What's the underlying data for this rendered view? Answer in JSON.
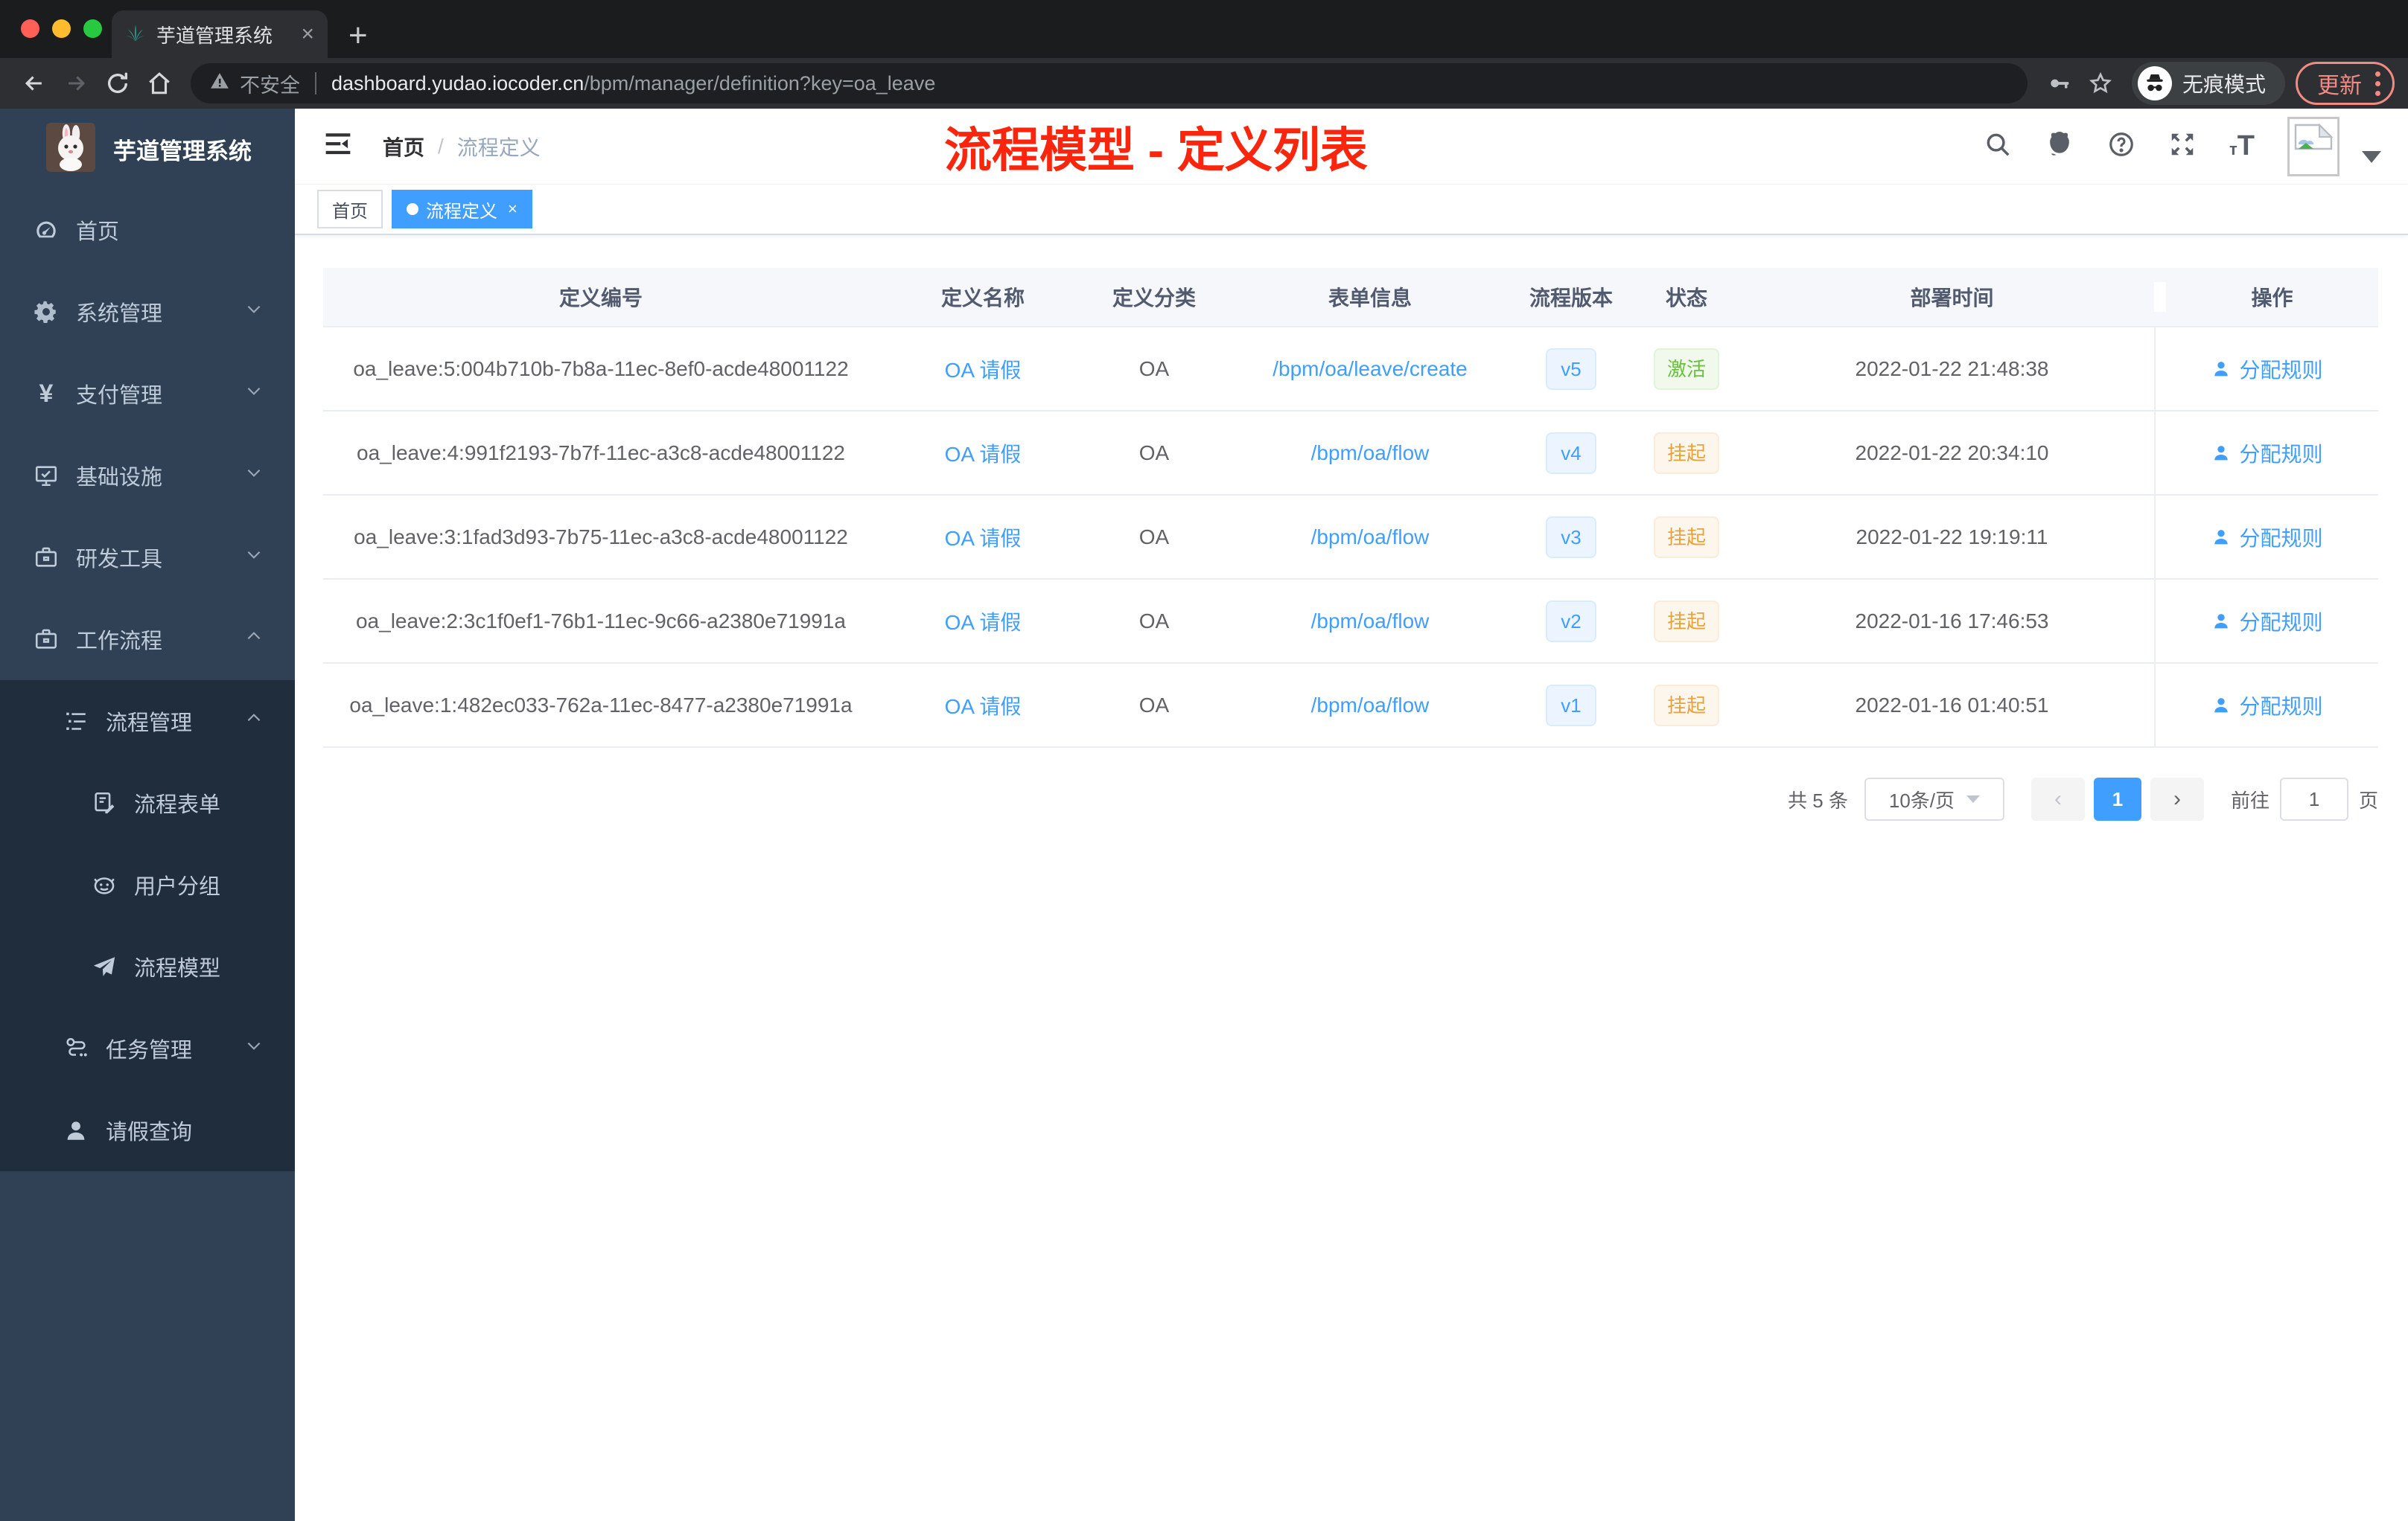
{
  "browser": {
    "tab_title": "芋道管理系统",
    "tab_close": "×",
    "new_tab": "+",
    "security_label": "不安全",
    "url_domain": "dashboard.yudao.iocoder.cn",
    "url_path": "/bpm/manager/definition?key=oa_leave",
    "incognito_label": "无痕模式",
    "update_label": "更新"
  },
  "sidebar": {
    "app_title": "芋道管理系统",
    "items": [
      {
        "label": "首页"
      },
      {
        "label": "系统管理"
      },
      {
        "label": "支付管理"
      },
      {
        "label": "基础设施"
      },
      {
        "label": "研发工具"
      },
      {
        "label": "工作流程"
      },
      {
        "label": "流程管理"
      },
      {
        "label": "流程表单"
      },
      {
        "label": "用户分组"
      },
      {
        "label": "流程模型"
      },
      {
        "label": "任务管理"
      },
      {
        "label": "请假查询"
      }
    ]
  },
  "header": {
    "breadcrumb_home": "首页",
    "breadcrumb_sep": "/",
    "breadcrumb_current": "流程定义",
    "annotation": "流程模型 - 定义列表"
  },
  "tags": {
    "home": "首页",
    "active": "流程定义",
    "close": "×"
  },
  "table": {
    "columns": [
      "定义编号",
      "定义名称",
      "定义分类",
      "表单信息",
      "流程版本",
      "状态",
      "部署时间",
      "操作"
    ],
    "rows": [
      {
        "id": "oa_leave:5:004b710b-7b8a-11ec-8ef0-acde48001122",
        "name": "OA 请假",
        "category": "OA",
        "form": "/bpm/oa/leave/create",
        "version": "v5",
        "status": "激活",
        "status_type": "active",
        "time": "2022-01-22 21:48:38",
        "action": "分配规则"
      },
      {
        "id": "oa_leave:4:991f2193-7b7f-11ec-a3c8-acde48001122",
        "name": "OA 请假",
        "category": "OA",
        "form": "/bpm/oa/flow",
        "version": "v4",
        "status": "挂起",
        "status_type": "suspend",
        "time": "2022-01-22 20:34:10",
        "action": "分配规则"
      },
      {
        "id": "oa_leave:3:1fad3d93-7b75-11ec-a3c8-acde48001122",
        "name": "OA 请假",
        "category": "OA",
        "form": "/bpm/oa/flow",
        "version": "v3",
        "status": "挂起",
        "status_type": "suspend",
        "time": "2022-01-22 19:19:11",
        "action": "分配规则"
      },
      {
        "id": "oa_leave:2:3c1f0ef1-76b1-11ec-9c66-a2380e71991a",
        "name": "OA 请假",
        "category": "OA",
        "form": "/bpm/oa/flow",
        "version": "v2",
        "status": "挂起",
        "status_type": "suspend",
        "time": "2022-01-16 17:46:53",
        "action": "分配规则"
      },
      {
        "id": "oa_leave:1:482ec033-762a-11ec-8477-a2380e71991a",
        "name": "OA 请假",
        "category": "OA",
        "form": "/bpm/oa/flow",
        "version": "v1",
        "status": "挂起",
        "status_type": "suspend",
        "time": "2022-01-16 01:40:51",
        "action": "分配规则"
      }
    ]
  },
  "pagination": {
    "total": "共 5 条",
    "page_size": "10条/页",
    "prev": "‹",
    "page": "1",
    "next": "›",
    "goto_label": "前往",
    "goto_value": "1",
    "page_unit": "页"
  },
  "colors": {
    "accent_blue": "#409eff",
    "sidebar_bg": "#304156",
    "submenu_bg": "#1f2d3d",
    "success_green": "#67c23a",
    "warning_orange": "#e6a23c",
    "annotation_red": "#f9250d"
  }
}
